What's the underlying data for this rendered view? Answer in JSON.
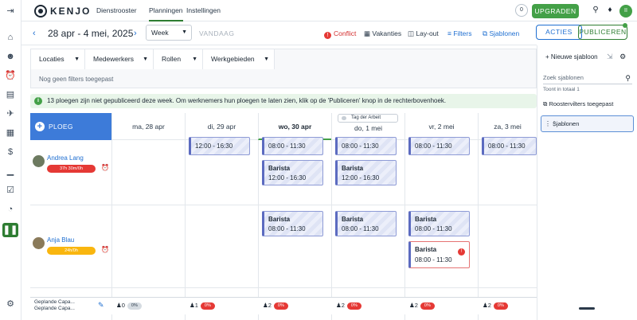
{
  "topbar": {
    "logo_text": "KENJO",
    "nav": [
      "Dienstrooster",
      "Planningen",
      "Instellingen"
    ],
    "notification_count": "0",
    "upgrade_label": "UPGRADEN",
    "avatar_initials": "II"
  },
  "toolbar": {
    "date_range": "28 apr - 4 mei, 2025",
    "view": "Week",
    "today_label": "VANDAAG",
    "conflict_label": "Conflict",
    "vacancies_label": "Vakanties",
    "layout_label": "Lay-out",
    "filters_label": "Filters",
    "templates_label": "Sjablonen",
    "actions_label": "ACTIES",
    "publish_label": "PUBLICEREN"
  },
  "filters": {
    "selects": [
      "Locaties",
      "Medewerkers",
      "Rollen",
      "Werkgebieden"
    ],
    "empty_text": "Nog geen filters toegepast"
  },
  "banner": {
    "text": "13 ploegen zijn niet gepubliceerd deze week. Om werknemers hun ploegen te laten zien, klik op de 'Publiceren' knop in de rechterbovenhoek."
  },
  "schedule": {
    "add_shift_label": "PLOEG TOEVOEGEN",
    "days": [
      "ma, 28 apr",
      "di, 29 apr",
      "wo, 30 apr",
      "do, 1 mei",
      "vr, 2 mei",
      "za, 3 mei"
    ],
    "holiday": "Tag der Arbeit",
    "employees": [
      {
        "name": "Andrea Lang",
        "hours": "37h 30m/0h",
        "hours_color": "#e53935"
      },
      {
        "name": "Anja Blau",
        "hours": "24h/0h",
        "hours_color": "#f9b60f"
      }
    ],
    "shifts": {
      "row0_partial": [
        {
          "time": "12:00 - 16:30"
        },
        {
          "time": "08:00 - 11:30"
        },
        {
          "time": "08:00 - 11:30"
        },
        {
          "time": "08:00 - 11:30"
        },
        {
          "time": "08:00 - 11:30"
        }
      ],
      "row0_full": [
        {
          "role": "Barista",
          "time": "12:00 - 16:30"
        },
        {
          "role": "Barista",
          "time": "12:00 - 16:30"
        }
      ],
      "row1": [
        {
          "role": "Barista",
          "time": "08:00 - 11:30"
        },
        {
          "role": "Barista",
          "time": "08:00 - 11:30"
        },
        {
          "role": "Barista",
          "time": "08:00 - 11:30"
        },
        {
          "role": "Barista",
          "time": "08:00 - 11:30"
        }
      ]
    }
  },
  "capacity": {
    "label_line1": "Geplande Capa...",
    "label_line2": "Geplande Capa...",
    "counts": [
      "0",
      "1",
      "2",
      "2",
      "2",
      "2"
    ],
    "percents": [
      "0%",
      "0%",
      "0%",
      "0%",
      "0%",
      "0%"
    ]
  },
  "panel": {
    "new_template_label": "Nieuwe sjabloon",
    "search_placeholder": "Zoek sjablonen",
    "total_text": "Toont in totaal 1",
    "apply_label": "Roostervilters toegepast",
    "template_name": "Sjablonen"
  },
  "colors": {
    "accent_green": "#43a047",
    "accent_blue": "#1f6fd1",
    "conflict_red": "#e53935"
  }
}
